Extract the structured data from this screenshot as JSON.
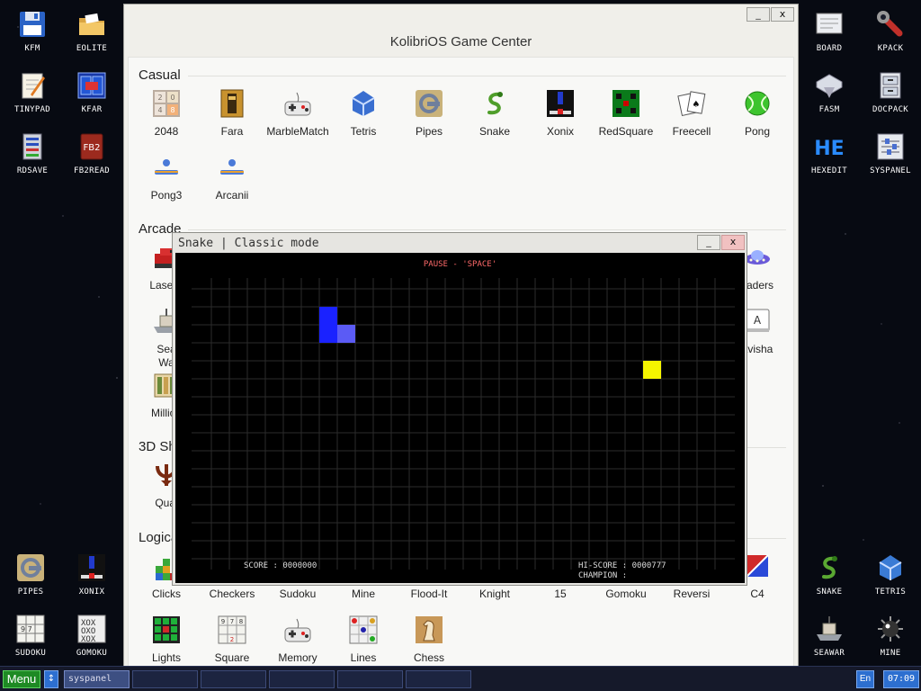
{
  "desktop_left": [
    {
      "label": "KFM",
      "icon": "floppy-disk-icon"
    },
    {
      "label": "EOLITE",
      "icon": "folder-icon"
    },
    {
      "label": "TINYPAD",
      "icon": "notepad-icon"
    },
    {
      "label": "KFAR",
      "icon": "blue-panels-icon"
    },
    {
      "label": "RDSAVE",
      "icon": "ram-disk-icon"
    },
    {
      "label": "FB2READ",
      "icon": "book-icon",
      "badge": "FB2"
    },
    {
      "label": "PIPES",
      "icon": "pipes-icon"
    },
    {
      "label": "XONIX",
      "icon": "xonix-icon"
    },
    {
      "label": "SUDOKU",
      "icon": "sudoku-icon"
    },
    {
      "label": "GOMOKU",
      "icon": "gomoku-icon"
    }
  ],
  "desktop_right": [
    {
      "label": "BOARD",
      "icon": "board-icon"
    },
    {
      "label": "KPACK",
      "icon": "wrench-icon"
    },
    {
      "label": "FASM",
      "icon": "fasm-icon"
    },
    {
      "label": "DOCPACK",
      "icon": "cabinet-icon"
    },
    {
      "label": "HEXEDIT",
      "icon": "hex-icon",
      "badge": "HE"
    },
    {
      "label": "SYSPANEL",
      "icon": "sliders-icon"
    },
    {
      "label": "SNAKE",
      "icon": "snake-icon"
    },
    {
      "label": "TETRIS",
      "icon": "tetris-icon"
    },
    {
      "label": "SEAWAR",
      "icon": "ship-icon"
    },
    {
      "label": "MINE",
      "icon": "mine-icon"
    }
  ],
  "game_center": {
    "title": "KolibriOS Game Center",
    "minimize": "_",
    "close": "x",
    "sections": {
      "casual": {
        "label": "Casual",
        "games": [
          {
            "label": "2048",
            "icon": "2048-icon"
          },
          {
            "label": "Fara",
            "icon": "pharaoh-icon"
          },
          {
            "label": "MarbleMatch",
            "icon": "gamepad-icon"
          },
          {
            "label": "Tetris",
            "icon": "tetris-icon"
          },
          {
            "label": "Pipes",
            "icon": "pipes-icon"
          },
          {
            "label": "Snake",
            "icon": "snake-icon"
          },
          {
            "label": "Xonix",
            "icon": "xonix-icon"
          },
          {
            "label": "RedSquare",
            "icon": "redsquare-icon"
          },
          {
            "label": "Freecell",
            "icon": "cards-icon"
          },
          {
            "label": "Pong",
            "icon": "tennis-ball-icon"
          },
          {
            "label": "Pong3",
            "icon": "paddle-icon"
          },
          {
            "label": "Arcanii",
            "icon": "paddle-icon"
          }
        ]
      },
      "arcade": {
        "label": "Arcade",
        "games": [
          {
            "label": "LaserT",
            "icon": "tank-icon"
          },
          {
            "label": "vaders",
            "icon": "ufo-icon"
          },
          {
            "label": "Sea",
            "label2": "Wa",
            "icon": "ship-icon"
          },
          {
            "label": "avisha",
            "icon": "keyboard-key-icon",
            "badge": "A"
          },
          {
            "label": "Million",
            "icon": "books-icon"
          }
        ]
      },
      "shooters": {
        "label": "3D Sh",
        "games": [
          {
            "label": "Qual",
            "icon": "quake-icon"
          }
        ]
      },
      "logical": {
        "label": "Logica",
        "games": [
          {
            "label": "Clicks",
            "icon": "clicks-icon"
          },
          {
            "label": "Checkers",
            "icon": "checkers-icon"
          },
          {
            "label": "Sudoku",
            "icon": "sudoku-icon"
          },
          {
            "label": "Mine",
            "icon": "mine-icon"
          },
          {
            "label": "Flood-It",
            "icon": "flood-icon"
          },
          {
            "label": "Knight",
            "icon": "knight-icon"
          },
          {
            "label": "15",
            "icon": "fifteen-icon"
          },
          {
            "label": "Gomoku",
            "icon": "gomoku-icon"
          },
          {
            "label": "Reversi",
            "icon": "reversi-icon"
          },
          {
            "label": "C4",
            "icon": "c4-icon"
          },
          {
            "label": "Lights",
            "icon": "lights-icon"
          },
          {
            "label": "Square",
            "icon": "square-icon"
          },
          {
            "label": "Memory",
            "icon": "gamepad-icon"
          },
          {
            "label": "Lines",
            "icon": "lines-icon"
          },
          {
            "label": "Chess",
            "icon": "chess-icon"
          }
        ]
      }
    }
  },
  "snake_window": {
    "title": "Snake | Classic mode",
    "minimize": "_",
    "close": "x",
    "pause_text": "PAUSE - 'SPACE'",
    "score_text": "SCORE : 0000000",
    "hiscore_text": "HI-SCORE : 0000777",
    "champion_text": "CHAMPION :",
    "grid": {
      "cols": 28,
      "rows": 15
    },
    "snake_cells": [
      {
        "col": 6,
        "row": 1,
        "color": "#1a22ff"
      },
      {
        "col": 6,
        "row": 2,
        "color": "#1a22ff"
      },
      {
        "col": 7,
        "row": 2,
        "color": "#5b5bf5"
      }
    ],
    "food": {
      "col": 24,
      "row": 4,
      "color": "#f5f500"
    }
  },
  "taskbar": {
    "menu": "Menu",
    "switch": "↕",
    "tasks": [
      "syspanel",
      "",
      "",
      "",
      "",
      ""
    ],
    "lang": "En",
    "clock": "07:09"
  }
}
